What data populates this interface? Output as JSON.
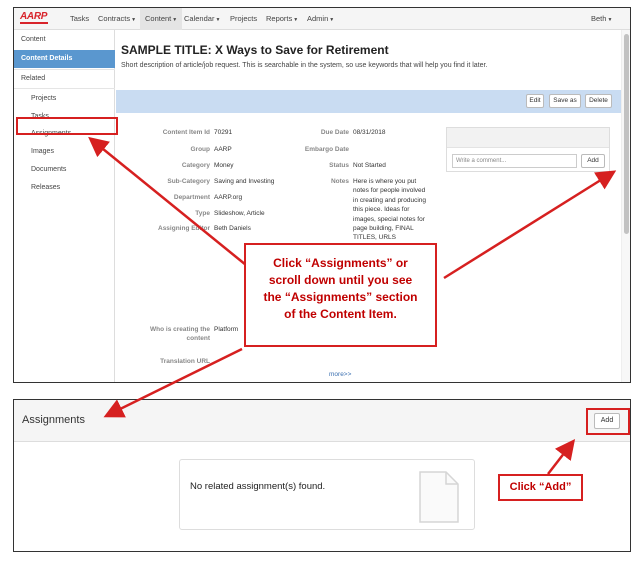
{
  "nav": {
    "logo": "AARP",
    "items": [
      "Tasks",
      "Contracts",
      "Content",
      "Calendar",
      "Projects",
      "Reports",
      "Admin"
    ],
    "user": "Beth"
  },
  "sidebar": {
    "header": "Content",
    "content_details": "Content Details",
    "related": "Related",
    "items": [
      "Projects",
      "Tasks",
      "Assignments",
      "Images",
      "Documents",
      "Releases"
    ]
  },
  "page": {
    "title": "SAMPLE TITLE: X Ways to Save for Retirement",
    "description": "Short description of article/job request. This is searchable in the system, so use keywords that will help you find it later."
  },
  "toolbar": {
    "edit": "Edit",
    "save_as": "Save as",
    "delete": "Delete"
  },
  "fields": {
    "content_item_id_label": "Content Item Id",
    "content_item_id": "70291",
    "group_label": "Group",
    "group": "AARP",
    "category_label": "Category",
    "category": "Money",
    "subcategory_label": "Sub-Category",
    "subcategory": "Saving and Investing",
    "department_label": "Department",
    "department": "AARP.org",
    "type_label": "Type",
    "type": "Slideshow, Article",
    "assigning_editor_label": "Assigning Editor",
    "assigning_editor": "Beth Daniels",
    "due_date_label": "Due Date",
    "due_date": "08/31/2018",
    "embargo_date_label": "Embargo Date",
    "status_label": "Status",
    "status": "Not Started",
    "notes_label": "Notes",
    "notes": "Here is where you put notes for people involved in creating and producing this piece. Ideas for images, special notes for page building, FINAL TITLES, URLS",
    "who_creating_label_1": "Who is creating the",
    "who_creating_label_2": "content",
    "who_creating": "Platform",
    "translation_url_label": "Translation URL",
    "more_link": "more>>"
  },
  "comment": {
    "placeholder": "Write a comment...",
    "add": "Add"
  },
  "assignments": {
    "title": "Assignments",
    "add": "Add",
    "empty_text": "No related assignment(s) found."
  },
  "callouts": {
    "main_lines": [
      "Click “Assignments” or",
      "scroll down until you see",
      "the “Assignments” section",
      "of the Content Item."
    ],
    "add": "Click “Add”"
  },
  "colors": {
    "annotation_red": "#d62020",
    "selected_blue": "#5a97cf",
    "toolbar_band": "#c9dcf2"
  }
}
